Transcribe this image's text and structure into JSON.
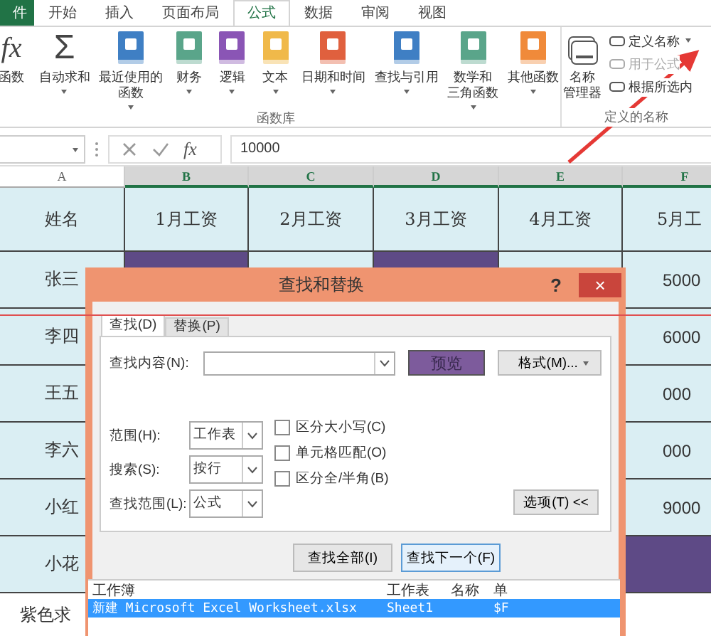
{
  "ribbon_tabs": [
    {
      "label": "件",
      "kind": "file",
      "selected": false
    },
    {
      "label": "开始",
      "kind": "tab",
      "selected": false
    },
    {
      "label": "插入",
      "kind": "tab",
      "selected": false
    },
    {
      "label": "页面布局",
      "kind": "tab",
      "selected": false
    },
    {
      "label": "公式",
      "kind": "tab",
      "selected": true
    },
    {
      "label": "数据",
      "kind": "tab",
      "selected": false
    },
    {
      "label": "审阅",
      "kind": "tab",
      "selected": false
    },
    {
      "label": "视图",
      "kind": "tab",
      "selected": false
    }
  ],
  "ribbon_groups": [
    {
      "label": "函数库",
      "items": [
        {
          "kind": "symbol",
          "symbol": "fx",
          "lines": [
            "函数"
          ]
        },
        {
          "kind": "symbol",
          "symbol": "Σ",
          "lines": [
            "自动求和"
          ],
          "dropdown": true
        },
        {
          "kind": "book",
          "color": "#3f7fc4",
          "lines": [
            "最近使用的",
            "函数"
          ],
          "dropdown": true
        },
        {
          "kind": "book",
          "color": "#5aa58a",
          "lines": [
            "财务"
          ],
          "dropdown": true
        },
        {
          "kind": "book",
          "color": "#8a55b5",
          "lines": [
            "逻辑"
          ],
          "dropdown": true
        },
        {
          "kind": "book",
          "color": "#f0b94a",
          "lines": [
            "文本"
          ],
          "dropdown": true
        },
        {
          "kind": "book",
          "color": "#e0603e",
          "lines": [
            "日期和时间"
          ],
          "dropdown": true
        },
        {
          "kind": "book",
          "color": "#3f7fc4",
          "lines": [
            "查找与引用"
          ],
          "dropdown": true
        },
        {
          "kind": "book",
          "color": "#5aa58a",
          "lines": [
            "数学和",
            "三角函数"
          ],
          "dropdown": true
        },
        {
          "kind": "book",
          "color": "#f08a3a",
          "lines": [
            "其他函数"
          ],
          "dropdown": true
        }
      ]
    },
    {
      "label": "定义的名称",
      "items": [
        {
          "kind": "manager",
          "lines": [
            "名称",
            "管理器"
          ]
        },
        {
          "kind": "small",
          "label": "定义名称",
          "disabled": false,
          "dropdown": true
        },
        {
          "kind": "small",
          "label": "用于公式",
          "disabled": true
        },
        {
          "kind": "small",
          "label": "根据所选内",
          "disabled": false
        }
      ]
    }
  ],
  "formula_bar": {
    "symbol": "fx",
    "value": "10000"
  },
  "sheet": {
    "columns": [
      {
        "label": "A",
        "selected": false
      },
      {
        "label": "B",
        "selected": true
      },
      {
        "label": "C",
        "selected": true
      },
      {
        "label": "D",
        "selected": true
      },
      {
        "label": "E",
        "selected": true
      },
      {
        "label": "F",
        "selected": true
      }
    ],
    "rows": [
      {
        "cells": [
          {
            "text": "姓名",
            "highlighted": false
          },
          {
            "text": "1月工资",
            "highlighted": false
          },
          {
            "text": "2月工资",
            "highlighted": false
          },
          {
            "text": "3月工资",
            "highlighted": false
          },
          {
            "text": "4月工资",
            "highlighted": false
          },
          {
            "text": "5月工",
            "highlighted": false
          }
        ]
      },
      {
        "cells": [
          {
            "text": "张三",
            "highlighted": false
          },
          {
            "highlighted": true
          },
          {
            "highlighted": false
          },
          {
            "highlighted": true
          },
          {
            "highlighted": false
          },
          {
            "text": "5000",
            "highlighted": false
          }
        ]
      },
      {
        "cells": [
          {
            "text": "李四",
            "highlighted": false
          },
          {},
          {},
          {},
          {},
          {
            "text": "6000",
            "highlighted": false
          }
        ]
      },
      {
        "cells": [
          {
            "text": "王五",
            "highlighted": false
          },
          {},
          {},
          {},
          {},
          {
            "text": "000",
            "highlighted": false
          }
        ]
      },
      {
        "cells": [
          {
            "text": "李六",
            "highlighted": false
          },
          {},
          {},
          {},
          {},
          {
            "text": "000",
            "highlighted": false
          }
        ]
      },
      {
        "cells": [
          {
            "text": "小红",
            "highlighted": false
          },
          {},
          {},
          {},
          {},
          {
            "text": "9000",
            "highlighted": false
          }
        ]
      },
      {
        "cells": [
          {
            "text": "小花",
            "highlighted": false
          },
          {},
          {},
          {},
          {},
          {
            "highlighted": true
          }
        ]
      },
      {
        "cells": [
          {
            "text": "紫色求"
          }
        ]
      }
    ]
  },
  "dialog": {
    "title": "查找和替换",
    "help": "?",
    "close": "×",
    "tabs": [
      {
        "label": "查找(D)",
        "selected": true
      },
      {
        "label": "替换(P)",
        "selected": false
      }
    ],
    "find_label": "查找内容(N):",
    "preview_button": "预览",
    "format_button": "格式(M)...",
    "options": [
      {
        "label": "范围(H):",
        "value": "工作表"
      },
      {
        "label": "搜索(S):",
        "value": "按行"
      },
      {
        "label": "查找范围(L):",
        "value": "公式"
      }
    ],
    "checkboxes": [
      {
        "label": "区分大小写(C)",
        "checked": false
      },
      {
        "label": "单元格匹配(O)",
        "checked": false
      },
      {
        "label": "区分全/半角(B)",
        "checked": false
      }
    ],
    "options_button": "选项(T) <<",
    "buttons": [
      {
        "label": "查找全部(I)",
        "focused": false
      },
      {
        "label": "查找下一个(F)",
        "focused": true
      }
    ],
    "results": {
      "columns": [
        "工作簿",
        "工作表",
        "名称",
        "单"
      ],
      "rows": [
        {
          "cells": [
            "新建 Microsoft Excel Worksheet.xlsx",
            "Sheet1",
            null,
            "$F"
          ],
          "selected": true
        }
      ]
    }
  }
}
